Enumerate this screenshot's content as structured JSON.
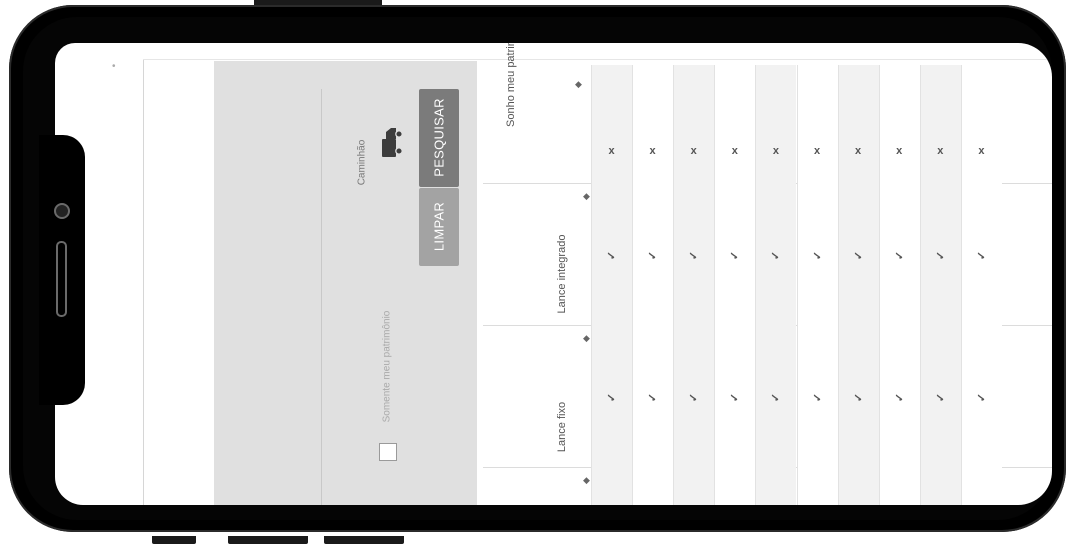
{
  "filter": {
    "vehicle_label": "Caminhão",
    "checkbox_label": "Somente meu patrimônio",
    "checkbox_checked": false,
    "search_button": "PESQUISAR",
    "clear_button": "LIMPAR"
  },
  "table": {
    "headers": [
      "Sonho meu patrimônio",
      "Lance integrado",
      "Lance fixo",
      ""
    ],
    "sort_icon": "sort-icon",
    "rows": [
      [
        "x",
        "✓",
        "✓",
        "✓"
      ],
      [
        "x",
        "✓",
        "✓",
        "✓"
      ],
      [
        "x",
        "✓",
        "✓",
        "✓"
      ],
      [
        "x",
        "✓",
        "✓",
        "✓"
      ],
      [
        "x",
        "✓",
        "✓",
        "✓"
      ],
      [
        "x",
        "✓",
        "✓",
        "✓"
      ],
      [
        "x",
        "✓",
        "✓",
        "✓"
      ],
      [
        "x",
        "✓",
        "✓",
        "✓"
      ],
      [
        "x",
        "✓",
        "✓",
        "✓"
      ],
      [
        "x",
        "✓",
        "✓",
        "✓"
      ]
    ]
  },
  "colors": {
    "panel_bg": "#e0e0e0",
    "search_button_bg": "#7b7b7b",
    "clear_button_bg": "#a3a3a3",
    "stripe": "#f2f2f2"
  }
}
